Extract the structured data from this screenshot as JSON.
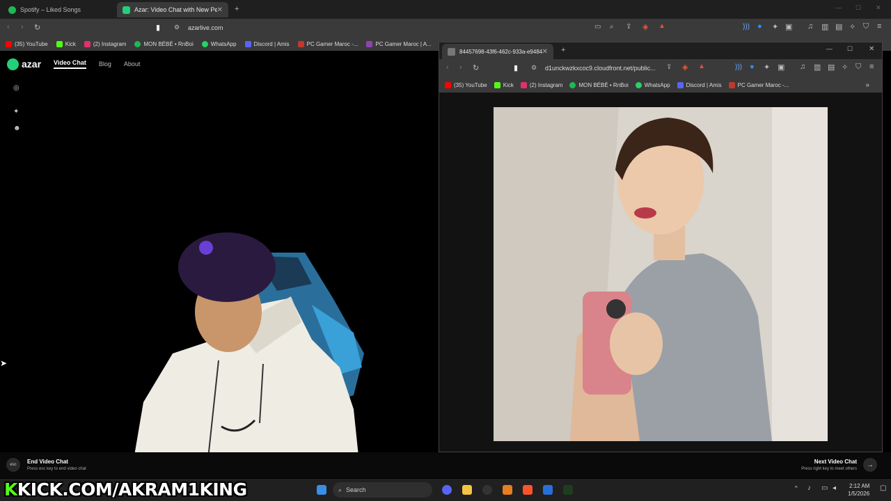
{
  "browser": {
    "tabs": [
      {
        "label": "Spotify – Liked Songs",
        "color": "#1db954"
      },
      {
        "label": "Azar: Video Chat with New Pe",
        "color": "#23d07a"
      }
    ],
    "url": "azarlive.com",
    "bookmarks": [
      {
        "label": "(35) YouTube",
        "color": "#ff0000"
      },
      {
        "label": "Kick",
        "color": "#53fc18"
      },
      {
        "label": "(2) Instagram",
        "color": "#e1306c"
      },
      {
        "label": "MON BÉBÉ • RnBoi",
        "color": "#1db954"
      },
      {
        "label": "WhatsApp",
        "color": "#25d366"
      },
      {
        "label": "Discord | Amis",
        "color": "#5865f2"
      },
      {
        "label": "PC Gamer Maroc -...",
        "color": "#c0392b"
      },
      {
        "label": "PC Gamer Maroc | A...",
        "color": "#8e44ad"
      }
    ]
  },
  "azar": {
    "logo": "azar",
    "nav": [
      "Video Chat",
      "Blog",
      "About"
    ],
    "end_key": "esc",
    "end_title": "End Video Chat",
    "end_hint": "Press esc key to end video chat",
    "next_title": "Next Video Chat",
    "next_hint": "Press right key to meet others"
  },
  "popup": {
    "tab_label": "84457698-43f6-462c-933a-e9484",
    "url": "d1unckwzkxcoc9.cloudfront.net/public...",
    "bookmarks": [
      {
        "label": "(35) YouTube",
        "color": "#ff0000"
      },
      {
        "label": "Kick",
        "color": "#53fc18"
      },
      {
        "label": "(2) Instagram",
        "color": "#e1306c"
      },
      {
        "label": "MON BÉBÉ • RnBoi",
        "color": "#1db954"
      },
      {
        "label": "WhatsApp",
        "color": "#25d366"
      },
      {
        "label": "Discord | Amis",
        "color": "#5865f2"
      },
      {
        "label": "PC Gamer Maroc -...",
        "color": "#c0392b"
      }
    ]
  },
  "overlay": {
    "kick_prefix": "K",
    "kick_text": "KICK.COM/AKRAM1KING"
  },
  "taskbar": {
    "search_placeholder": "Search",
    "time": "2:12 AM",
    "date": "1/5/2026"
  }
}
